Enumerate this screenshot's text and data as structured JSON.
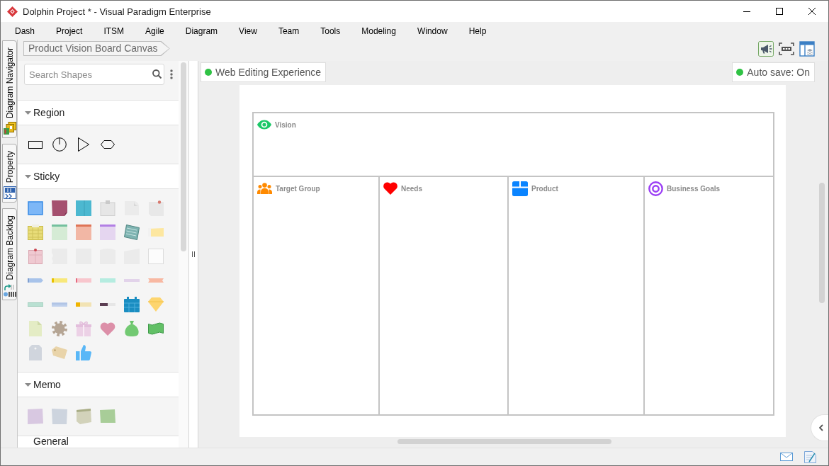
{
  "window": {
    "title": "Dolphin Project * - Visual Paradigm Enterprise"
  },
  "menu": [
    "Dash",
    "Project",
    "ITSM",
    "Agile",
    "Diagram",
    "View",
    "Team",
    "Tools",
    "Modeling",
    "Window",
    "Help"
  ],
  "side_tabs": [
    {
      "label": "Diagram Navigator",
      "selected": false
    },
    {
      "label": "Property",
      "selected": false
    },
    {
      "label": "Diagram Backlog",
      "selected": false
    }
  ],
  "breadcrumb": "Product Vision Board Canvas",
  "toolbar": [
    {
      "kind": "megaphone",
      "on": true
    },
    {
      "kind": "fit",
      "on": false
    },
    {
      "kind": "layout",
      "on": false
    }
  ],
  "palette": {
    "search": {
      "placeholder": "Search Shapes"
    },
    "sections": [
      {
        "title": "Region",
        "expanded": true
      },
      {
        "title": "Sticky",
        "expanded": true
      },
      {
        "title": "Memo",
        "expanded": true
      },
      {
        "title": "General"
      }
    ]
  },
  "canvas": {
    "badges": [
      {
        "label": "Web Editing Experience"
      },
      {
        "label": "Auto save: On"
      }
    ],
    "board": {
      "vision": {
        "title": "Vision",
        "kind": "eye",
        "color": "#1cc868"
      },
      "columns": [
        {
          "title": "Target Group",
          "kind": "people",
          "color": "#ff8a00"
        },
        {
          "title": "Needs",
          "kind": "heart",
          "color": "#ff0000"
        },
        {
          "title": "Product",
          "kind": "box",
          "color": "#0a84ff"
        },
        {
          "title": "Business Goals",
          "kind": "target",
          "color": "#9b3ef5"
        }
      ]
    }
  }
}
